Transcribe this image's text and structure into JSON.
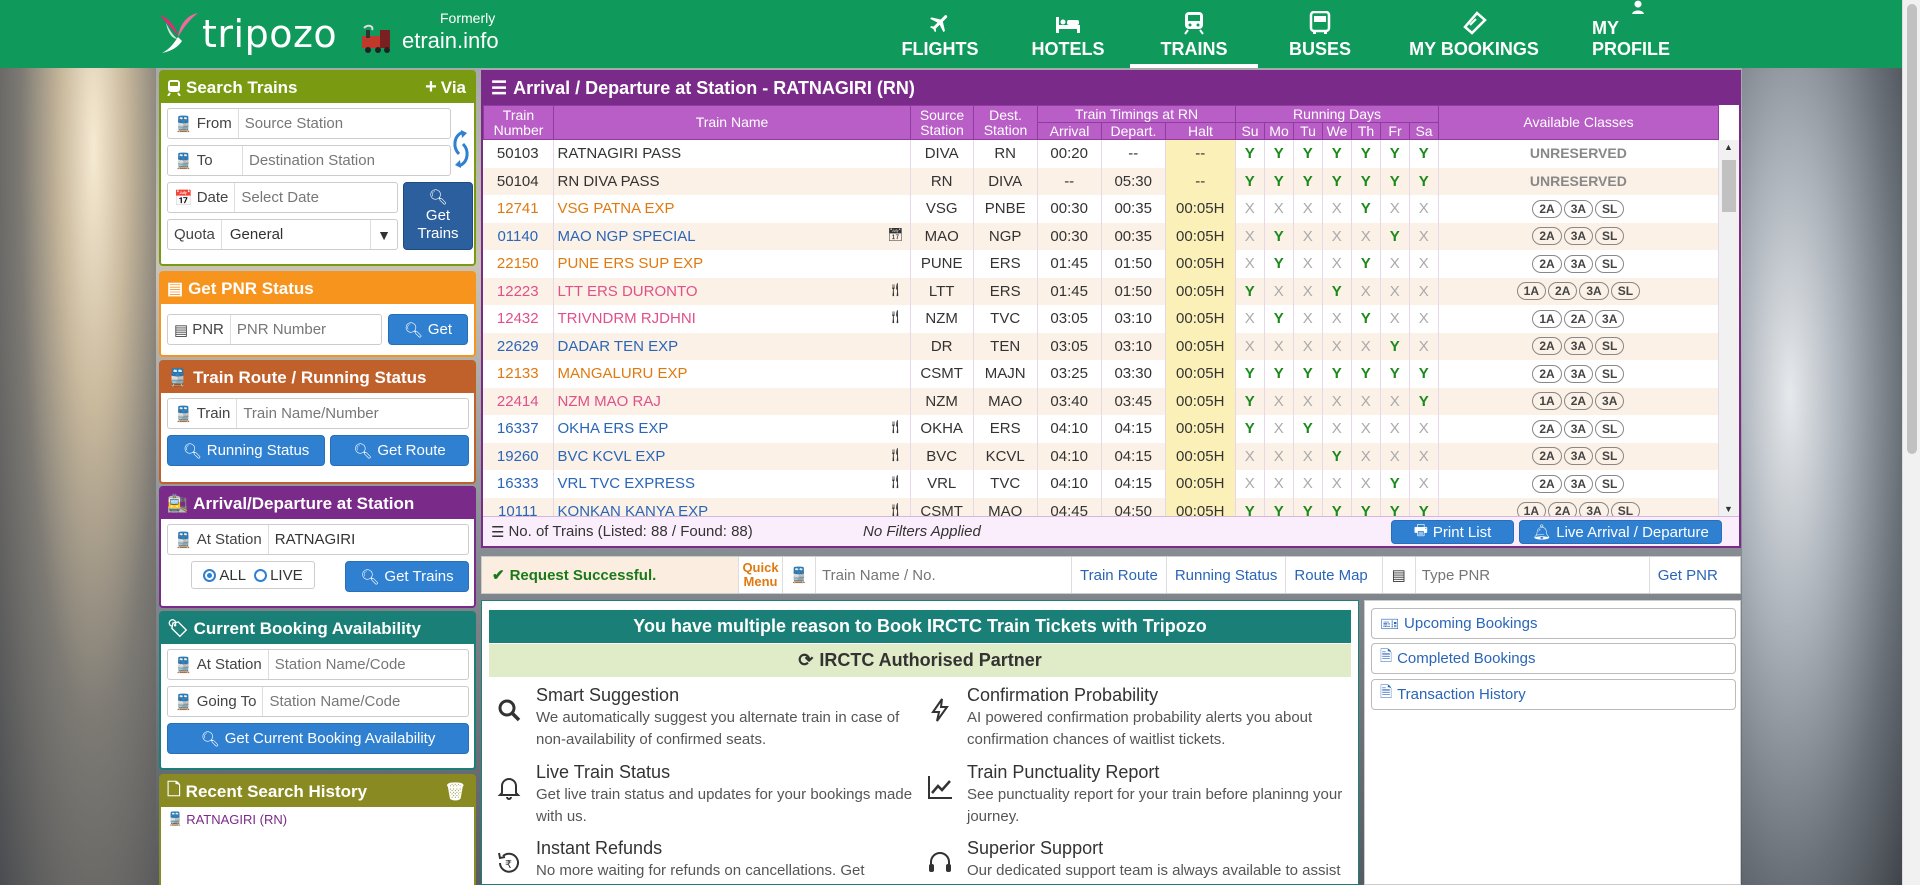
{
  "header": {
    "brand": "tripozo",
    "formerly_label": "Formerly",
    "formerly_brand": "etrain.info",
    "nav": [
      {
        "label": "FLIGHTS",
        "icon": "plane-icon"
      },
      {
        "label": "HOTELS",
        "icon": "bed-icon"
      },
      {
        "label": "TRAINS",
        "icon": "train-icon",
        "active": true
      },
      {
        "label": "BUSES",
        "icon": "bus-icon"
      },
      {
        "label": "MY BOOKINGS",
        "icon": "ticket-icon"
      },
      {
        "label": "MY PROFILE",
        "icon": "user-icon"
      }
    ]
  },
  "search_trains": {
    "title": "Search Trains",
    "via_label": "Via",
    "from_label": "From",
    "from_placeholder": "Source Station",
    "to_label": "To",
    "to_placeholder": "Destination Station",
    "date_label": "Date",
    "date_placeholder": "Select Date",
    "quota_label": "Quota",
    "quota_value": "General",
    "get_trains_label": "Get Trains"
  },
  "pnr": {
    "title": "Get PNR Status",
    "label": "PNR",
    "placeholder": "PNR Number",
    "button": "Get"
  },
  "route": {
    "title": "Train Route / Running Status",
    "label": "Train",
    "placeholder": "Train Name/Number",
    "running_status": "Running Status",
    "get_route": "Get Route"
  },
  "arrdep": {
    "title": "Arrival/Departure at Station",
    "label": "At Station",
    "value": "RATNAGIRI",
    "opt_all": "ALL",
    "opt_live": "LIVE",
    "button": "Get Trains"
  },
  "availability": {
    "title": "Current Booking Availability",
    "at_label": "At Station",
    "at_placeholder": "Station Name/Code",
    "going_label": "Going To",
    "going_placeholder": "Station Name/Code",
    "button": "Get Current Booking Availability"
  },
  "history": {
    "title": "Recent Search History",
    "items": [
      "RATNAGIRI (RN)"
    ]
  },
  "table_panel": {
    "title": "Arrival / Departure at Station - RATNAGIRI (RN)",
    "headers": {
      "train_number": "Train Number",
      "train_name": "Train Name",
      "source": "Source Station",
      "dest": "Dest. Station",
      "timings": "Train Timings at RN",
      "arrival": "Arrival",
      "depart": "Depart.",
      "halt": "Halt",
      "running_days": "Running Days",
      "days": [
        "Su",
        "Mo",
        "Tu",
        "We",
        "Th",
        "Fr",
        "Sa"
      ],
      "classes": "Available Classes"
    },
    "rows": [
      {
        "no": "50103",
        "name": "RATNAGIRI PASS",
        "color": "#333333",
        "src": "DIVA",
        "dst": "RN",
        "arr": "00:20",
        "dep": "--",
        "halt": "--",
        "days": "YYYYYYY",
        "classes": [
          "UNRESERVED"
        ],
        "icon": ""
      },
      {
        "no": "50104",
        "name": "RN DIVA PASS",
        "color": "#333333",
        "src": "RN",
        "dst": "DIVA",
        "arr": "--",
        "dep": "05:30",
        "halt": "--",
        "days": "YYYYYYY",
        "classes": [
          "UNRESERVED"
        ],
        "icon": ""
      },
      {
        "no": "12741",
        "name": "VSG PATNA EXP",
        "color": "#e07a10",
        "src": "VSG",
        "dst": "PNBE",
        "arr": "00:30",
        "dep": "00:35",
        "halt": "00:05H",
        "days": "XXXXYXX",
        "classes": [
          "2A",
          "3A",
          "SL"
        ],
        "icon": ""
      },
      {
        "no": "01140",
        "name": "MAO NGP SPECIAL",
        "color": "#2a65b8",
        "src": "MAO",
        "dst": "NGP",
        "arr": "00:30",
        "dep": "00:35",
        "halt": "00:05H",
        "days": "XYXXXYX",
        "classes": [
          "2A",
          "3A",
          "SL"
        ],
        "icon": "calendar"
      },
      {
        "no": "22150",
        "name": "PUNE ERS SUP EXP",
        "color": "#e07a10",
        "src": "PUNE",
        "dst": "ERS",
        "arr": "01:45",
        "dep": "01:50",
        "halt": "00:05H",
        "days": "XYXXYXX",
        "classes": [
          "2A",
          "3A",
          "SL"
        ],
        "icon": ""
      },
      {
        "no": "12223",
        "name": "LTT ERS DURONTO",
        "color": "#e0508a",
        "src": "LTT",
        "dst": "ERS",
        "arr": "01:45",
        "dep": "01:50",
        "halt": "00:05H",
        "days": "YXXYXXX",
        "classes": [
          "1A",
          "2A",
          "3A",
          "SL"
        ],
        "icon": "food"
      },
      {
        "no": "12432",
        "name": "TRIVNDRM RJDHNI",
        "color": "#e0508a",
        "src": "NZM",
        "dst": "TVC",
        "arr": "03:05",
        "dep": "03:10",
        "halt": "00:05H",
        "days": "XYXXYXX",
        "classes": [
          "1A",
          "2A",
          "3A"
        ],
        "icon": "food"
      },
      {
        "no": "22629",
        "name": "DADAR TEN EXP",
        "color": "#2a65b8",
        "src": "DR",
        "dst": "TEN",
        "arr": "03:05",
        "dep": "03:10",
        "halt": "00:05H",
        "days": "XXXXXYX",
        "classes": [
          "2A",
          "3A",
          "SL"
        ],
        "icon": ""
      },
      {
        "no": "12133",
        "name": "MANGALURU EXP",
        "color": "#e07a10",
        "src": "CSMT",
        "dst": "MAJN",
        "arr": "03:25",
        "dep": "03:30",
        "halt": "00:05H",
        "days": "YYYYYYY",
        "classes": [
          "2A",
          "3A",
          "SL"
        ],
        "icon": ""
      },
      {
        "no": "22414",
        "name": "NZM MAO RAJ",
        "color": "#e0508a",
        "src": "NZM",
        "dst": "MAO",
        "arr": "03:40",
        "dep": "03:45",
        "halt": "00:05H",
        "days": "YXXXXXY",
        "classes": [
          "1A",
          "2A",
          "3A"
        ],
        "icon": ""
      },
      {
        "no": "16337",
        "name": "OKHA ERS EXP",
        "color": "#2a65b8",
        "src": "OKHA",
        "dst": "ERS",
        "arr": "04:10",
        "dep": "04:15",
        "halt": "00:05H",
        "days": "YXYXXXX",
        "classes": [
          "2A",
          "3A",
          "SL"
        ],
        "icon": "food"
      },
      {
        "no": "19260",
        "name": "BVC KCVL EXP",
        "color": "#2a65b8",
        "src": "BVC",
        "dst": "KCVL",
        "arr": "04:10",
        "dep": "04:15",
        "halt": "00:05H",
        "days": "XXXYXXX",
        "classes": [
          "2A",
          "3A",
          "SL"
        ],
        "icon": "food"
      },
      {
        "no": "16333",
        "name": "VRL TVC EXPRESS",
        "color": "#2a65b8",
        "src": "VRL",
        "dst": "TVC",
        "arr": "04:10",
        "dep": "04:15",
        "halt": "00:05H",
        "days": "XXXXXYX",
        "classes": [
          "2A",
          "3A",
          "SL"
        ],
        "icon": "food"
      },
      {
        "no": "10111",
        "name": "KONKAN KANYA EXP",
        "color": "#2a65b8",
        "src": "CSMT",
        "dst": "MAO",
        "arr": "04:45",
        "dep": "04:50",
        "halt": "00:05H",
        "days": "YYYYYYY",
        "classes": [
          "1A",
          "2A",
          "3A",
          "SL"
        ],
        "icon": "food"
      }
    ],
    "footer_count": "No. of Trains (Listed: 88 / Found: 88)",
    "footer_filters": "No Filters Applied",
    "print_label": "Print List",
    "live_label": "Live Arrival / Departure"
  },
  "quick": {
    "status": "Request Successful.",
    "menu_label_1": "Quick",
    "menu_label_2": "Menu",
    "train_placeholder": "Train Name / No.",
    "train_route": "Train Route",
    "running_status": "Running Status",
    "route_map": "Route Map",
    "pnr_placeholder": "Type PNR",
    "get_pnr": "Get PNR"
  },
  "info": {
    "title": "You have multiple reason to Book IRCTC Train Tickets with Tripozo",
    "partner": "IRCTC Authorised Partner",
    "features": [
      {
        "title": "Smart Suggestion",
        "desc": "We automatically suggest you alternate train in case of non-availability of confirmed seats.",
        "icon": "search-icon"
      },
      {
        "title": "Confirmation Probability",
        "desc": "AI powered confirmation probability alerts you about confirmation chances of waitlist tickets.",
        "icon": "bolt-icon"
      },
      {
        "title": "Live Train Status",
        "desc": "Get live train status and updates for your bookings made with us.",
        "icon": "bell-icon"
      },
      {
        "title": "Train Punctuality Report",
        "desc": "See punctuality report for your train before planinng your journey.",
        "icon": "line-chart-icon"
      },
      {
        "title": "Instant Refunds",
        "desc": "No more waiting for refunds on cancellations. Get",
        "icon": "refund-icon"
      },
      {
        "title": "Superior Support",
        "desc": "Our dedicated support team is always available to assist",
        "icon": "headset-icon"
      }
    ]
  },
  "side": {
    "links": [
      "Upcoming Bookings",
      "Completed Bookings",
      "Transaction History"
    ]
  },
  "colors": {
    "header_green": "#0f9a5b",
    "search_green": "#7a9a12",
    "pnr_orange": "#f7941d",
    "route_brown": "#c0602a",
    "arrdep_purple": "#7a2a88",
    "avail_teal": "#1a7f77",
    "history_olive": "#8a8a23",
    "button_blue": "#2f80d1"
  }
}
